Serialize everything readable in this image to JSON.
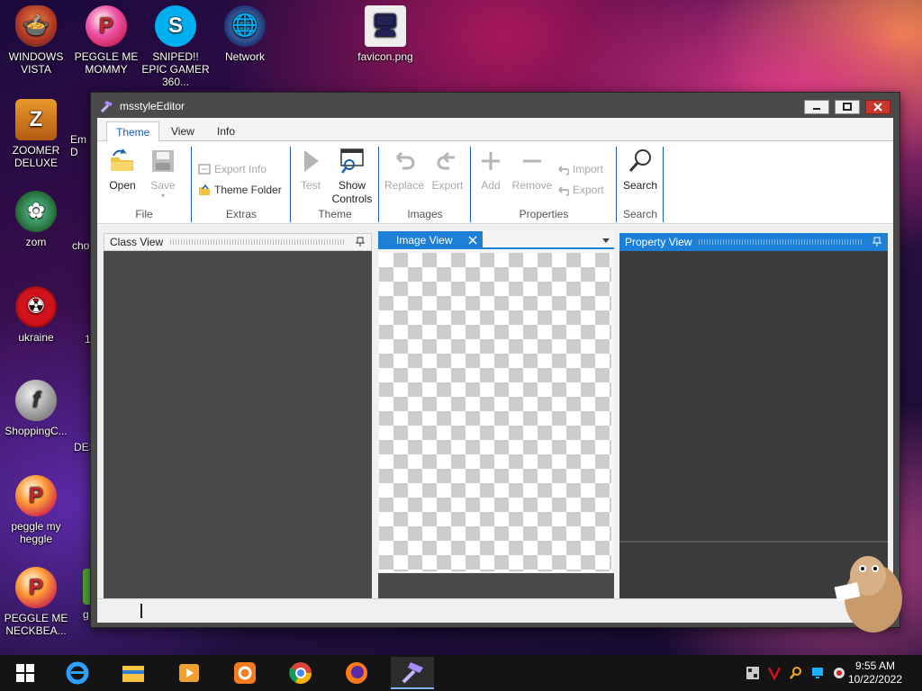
{
  "desktop": {
    "icons": [
      {
        "label": "WINDOWS VISTA",
        "name": "windows-vista-icon"
      },
      {
        "label": "PEGGLE ME MOMMY",
        "name": "peggle-icon"
      },
      {
        "label": "SNIPED!! EPIC GAMER 360...",
        "name": "skype-icon"
      },
      {
        "label": "Network",
        "name": "network-icon"
      },
      {
        "label": "favicon.png",
        "name": "favicon-file-icon"
      },
      {
        "label": "ZOOMER DELUXE",
        "name": "zoomer-deluxe-icon"
      },
      {
        "label": "Em D",
        "name": "partial-icon"
      },
      {
        "label": "zom",
        "name": "zom-icon"
      },
      {
        "label": "cho",
        "name": "partial-icon"
      },
      {
        "label": "ukraine",
        "name": "radiation-icon"
      },
      {
        "label": "1",
        "name": "partial-icon"
      },
      {
        "label": "ShoppingC...",
        "name": "flash-icon"
      },
      {
        "label": "DES",
        "name": "partial-icon"
      },
      {
        "label": "peggle my heggle",
        "name": "peggle-icon"
      },
      {
        "label": "PEGGLE ME NECKBEA...",
        "name": "peggle-icon"
      },
      {
        "label": "g porn",
        "name": "partial-icon"
      }
    ]
  },
  "window": {
    "title": "msstyleEditor",
    "tabs": [
      "Theme",
      "View",
      "Info"
    ],
    "active_tab": "Theme",
    "ribbon": {
      "file": {
        "label": "File",
        "open": "Open",
        "save": "Save"
      },
      "extras": {
        "label": "Extras",
        "export_info": "Export Info",
        "theme_folder": "Theme Folder"
      },
      "theme": {
        "label": "Theme",
        "test": "Test",
        "show_controls_1": "Show",
        "show_controls_2": "Controls"
      },
      "images": {
        "label": "Images",
        "replace": "Replace",
        "export": "Export"
      },
      "properties": {
        "label": "Properties",
        "add": "Add",
        "remove": "Remove",
        "import": "Import",
        "export": "Export"
      },
      "search": {
        "label": "Search",
        "search": "Search"
      }
    },
    "panels": {
      "class_view": "Class View",
      "image_view": "Image View",
      "property_view": "Property View"
    }
  },
  "taskbar": {
    "time": "9:55 AM",
    "date": "10/22/2022",
    "pinned": [
      "windows-start-icon",
      "internet-explorer-icon",
      "file-explorer-icon",
      "media-player-icon",
      "uc-browser-icon",
      "chrome-icon",
      "firefox-icon",
      "msstyleeditor-icon"
    ]
  },
  "colors": {
    "accent": "#1a5fb0",
    "panel_dark": "#4a4a4a",
    "active_header": "#1e7fd6"
  }
}
